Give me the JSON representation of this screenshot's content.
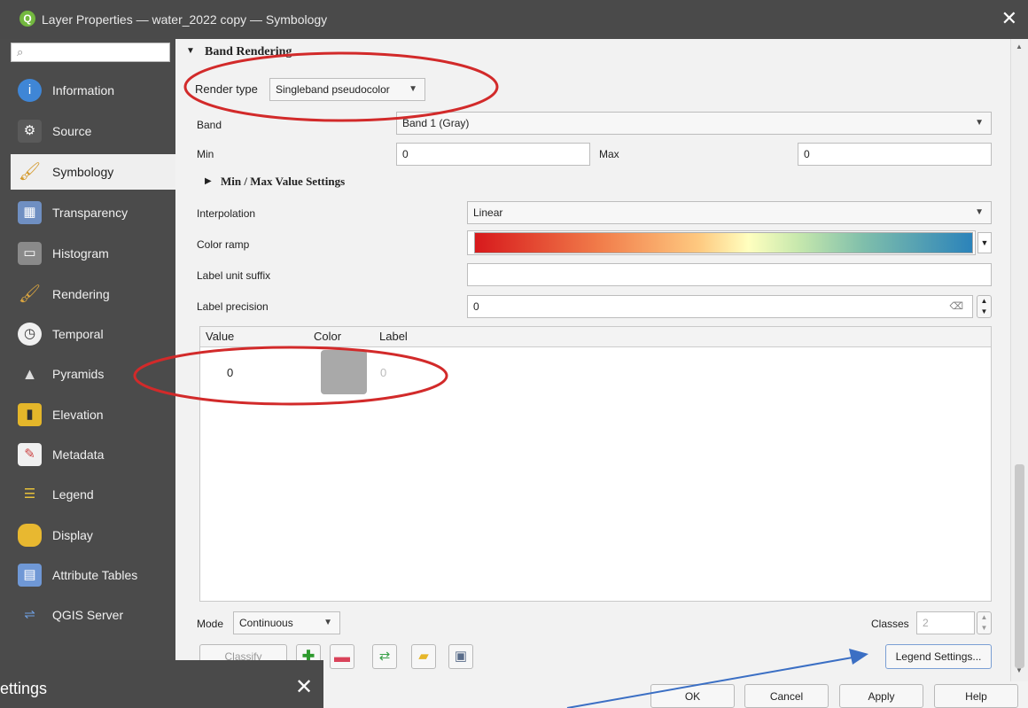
{
  "window": {
    "title": "Layer Properties — water_2022 copy — Symbology"
  },
  "sidebar": {
    "search_icon": "magnifier",
    "items": [
      {
        "label": "Information",
        "icon": "info-icon"
      },
      {
        "label": "Source",
        "icon": "source-icon"
      },
      {
        "label": "Symbology",
        "icon": "paintbrush-icon"
      },
      {
        "label": "Transparency",
        "icon": "transparency-icon"
      },
      {
        "label": "Histogram",
        "icon": "histogram-icon"
      },
      {
        "label": "Rendering",
        "icon": "rendering-brush-icon"
      },
      {
        "label": "Temporal",
        "icon": "clock-icon"
      },
      {
        "label": "Pyramids",
        "icon": "pyramid-icon"
      },
      {
        "label": "Elevation",
        "icon": "elevation-icon"
      },
      {
        "label": "Metadata",
        "icon": "metadata-icon"
      },
      {
        "label": "Legend",
        "icon": "legend-icon"
      },
      {
        "label": "Display",
        "icon": "speech-bubble-icon"
      },
      {
        "label": "Attribute Tables",
        "icon": "table-icon"
      },
      {
        "label": "QGIS Server",
        "icon": "server-icon"
      }
    ],
    "active": "Symbology"
  },
  "band_rendering": {
    "section_title": "Band Rendering",
    "render_type_label": "Render type",
    "render_type_value": "Singleband pseudocolor",
    "band_label": "Band",
    "band_value": "Band 1 (Gray)",
    "min_label": "Min",
    "min_value": "0",
    "max_label": "Max",
    "max_value": "0",
    "minmax_settings": "Min / Max Value Settings",
    "interpolation_label": "Interpolation",
    "interpolation_value": "Linear",
    "color_ramp_label": "Color ramp",
    "label_unit_suffix_label": "Label unit suffix",
    "label_unit_suffix_value": "",
    "label_precision_label": "Label precision",
    "label_precision_value": "0"
  },
  "class_table": {
    "headers": {
      "value": "Value",
      "color": "Color",
      "label": "Label"
    },
    "rows": [
      {
        "value": "0",
        "color": "#a9a9a9",
        "label": "0"
      }
    ]
  },
  "controls": {
    "mode_label": "Mode",
    "mode_value": "Continuous",
    "classes_label": "Classes",
    "classes_value": "2",
    "classify": "Classify",
    "legend_settings": "Legend Settings..."
  },
  "dialog_buttons": {
    "ok": "OK",
    "cancel": "Cancel",
    "apply": "Apply",
    "help": "Help"
  },
  "background_dialog": {
    "title_fragment": "ettings"
  },
  "annotation_colors": {
    "ellipse": "#d22a2a",
    "arrow": "#3b6fc4"
  }
}
